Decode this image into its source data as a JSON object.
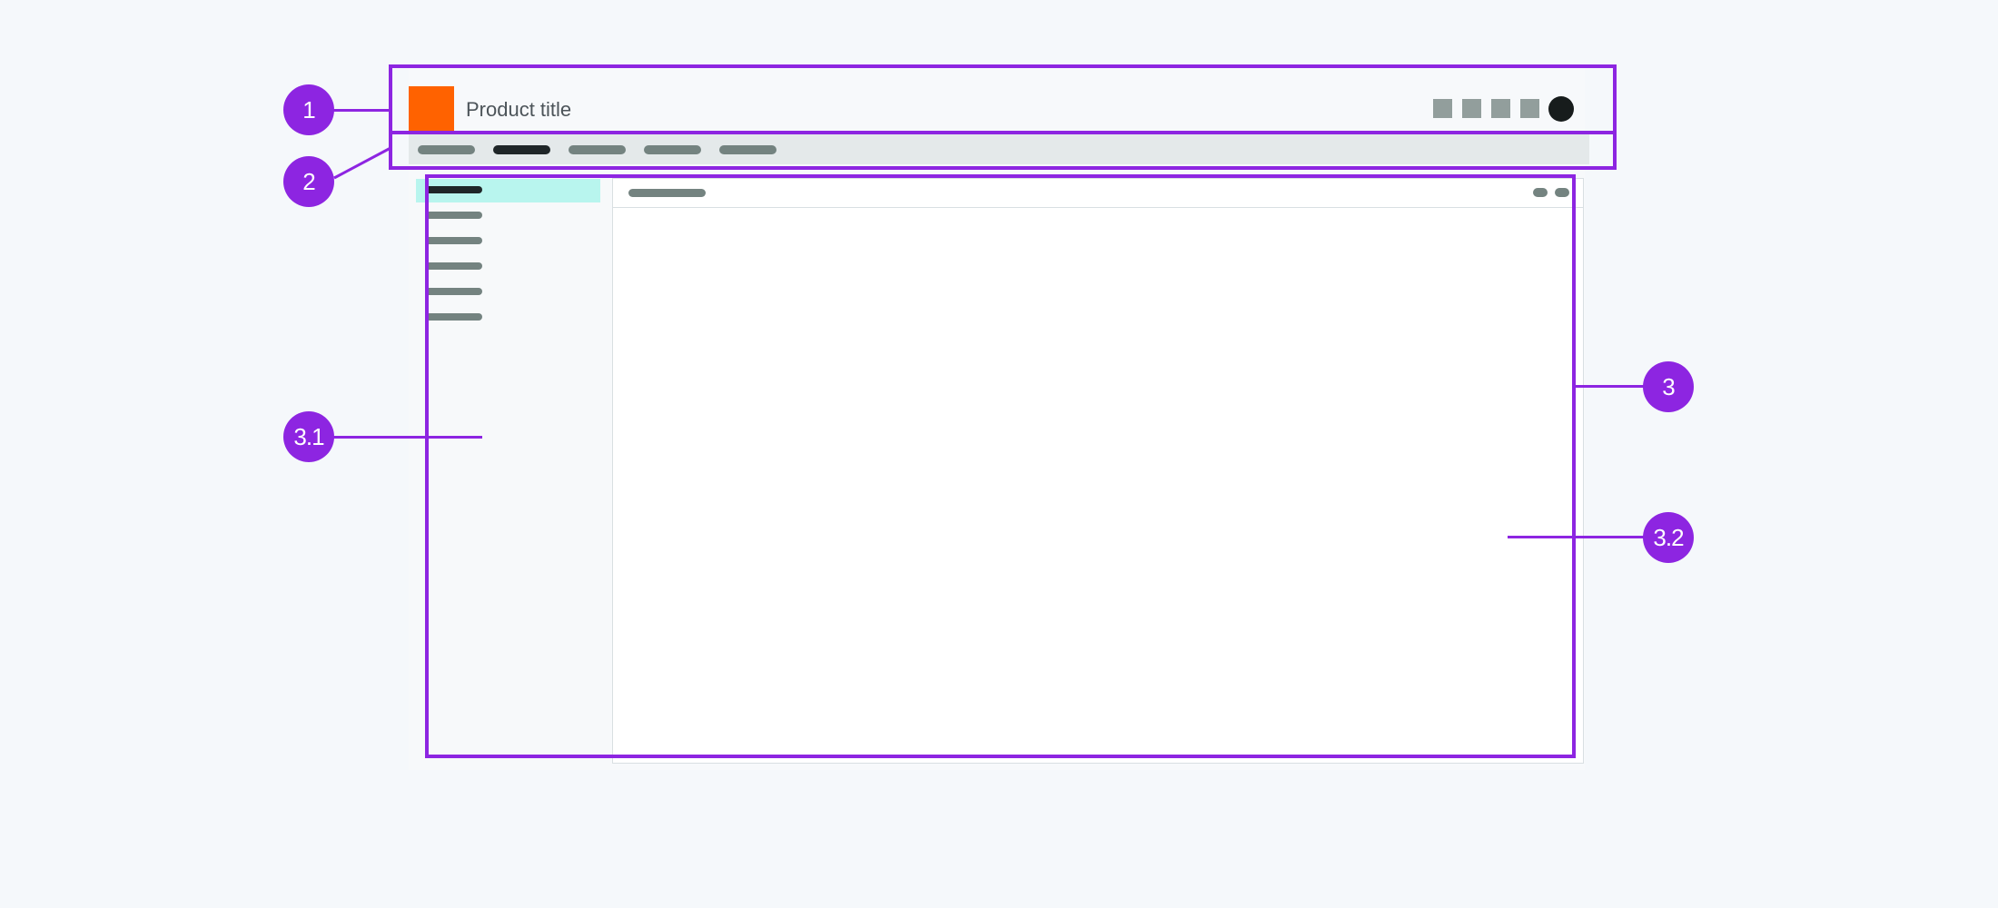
{
  "header": {
    "product_title": "Product title"
  },
  "callouts": [
    {
      "id": "header",
      "label": "1"
    },
    {
      "id": "nav",
      "label": "2"
    },
    {
      "id": "body",
      "label": "3"
    },
    {
      "id": "side-panel",
      "label": "3.1"
    },
    {
      "id": "content",
      "label": "3.2"
    }
  ],
  "colors": {
    "accent": "#8d25e1",
    "logo": "#ff6200",
    "active_highlight": "#b8f5ee",
    "background": "#f5f8fb"
  },
  "icons": {
    "header_actions": [
      "placeholder-square-icon",
      "placeholder-square-icon",
      "placeholder-square-icon",
      "placeholder-square-icon"
    ],
    "avatar": "avatar-circle-icon"
  }
}
